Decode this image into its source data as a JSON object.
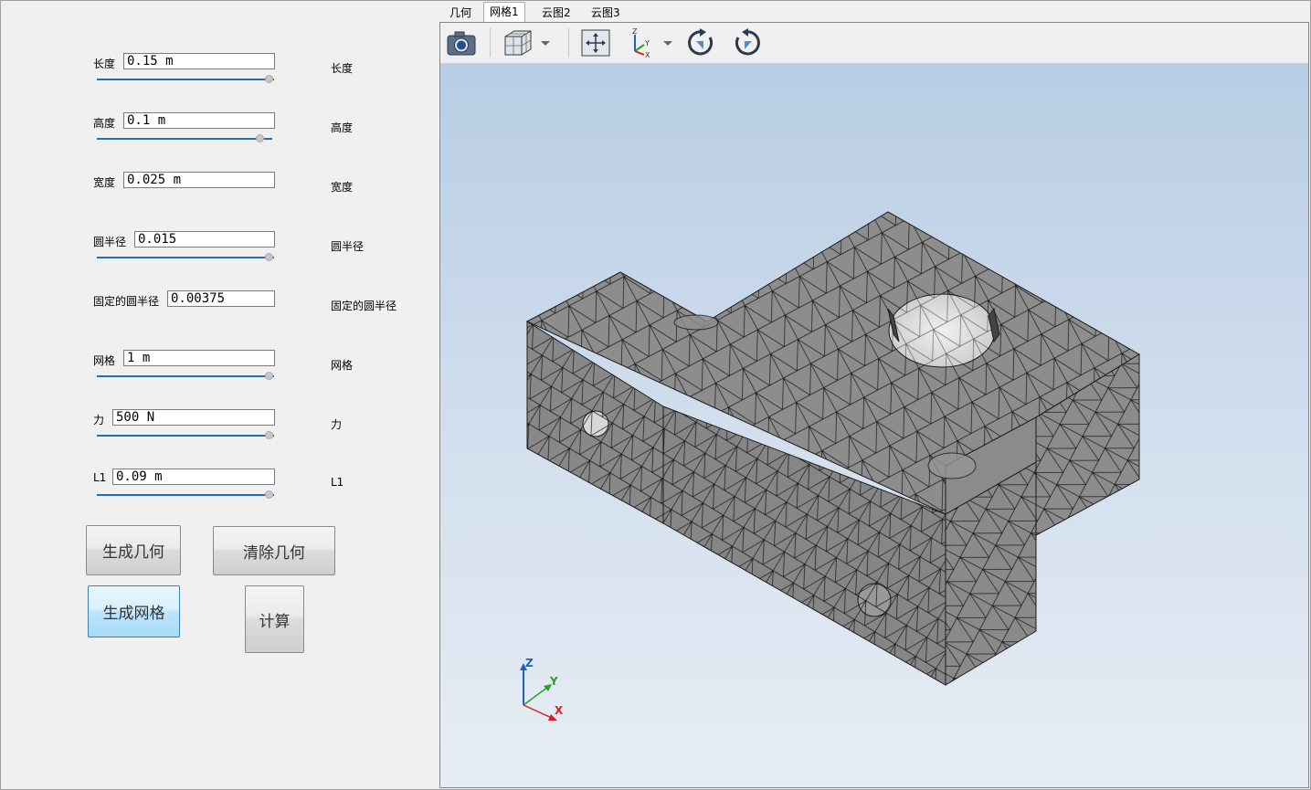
{
  "params": [
    {
      "label": "长度",
      "value": "0.15 m",
      "right": "长度",
      "slider": 0.98
    },
    {
      "label": "高度",
      "value": "0.1 m",
      "right": "高度",
      "slider": 0.92
    },
    {
      "label": "宽度",
      "value": "0.025 m",
      "right": "宽度",
      "slider": null
    },
    {
      "label": "圆半径",
      "value": "0.015",
      "right": "圆半径",
      "slider": 0.98
    },
    {
      "label": "固定的圆半径",
      "value": "0.00375",
      "right": "固定的圆半径",
      "slider": null
    },
    {
      "label": "网格",
      "value": "1 m",
      "right": "网格",
      "slider": 0.98
    },
    {
      "label": "力",
      "value": "500 N",
      "right": "力",
      "slider": 0.98
    },
    {
      "label": "L1",
      "value": "0.09 m",
      "right": "L1",
      "slider": 0.98
    }
  ],
  "buttons": {
    "generate_geometry": "生成几何",
    "clear_geometry": "清除几何",
    "generate_mesh": "生成网格",
    "compute": "计算"
  },
  "tabs": [
    "几何",
    "网格1",
    "云图2",
    "云图3"
  ],
  "selected_tab": 1,
  "toolbar": [
    "camera-icon",
    "view-cube-icon",
    "dropdown-arrow-icon",
    "zoom-extents-icon",
    "axes-orientation-icon",
    "dropdown-arrow-icon",
    "rotate-cw-icon",
    "rotate-ccw-icon"
  ],
  "axis_triad": {
    "z": "Z",
    "y": "Y",
    "x": "X"
  },
  "colors": {
    "accent": "#1e6fc0",
    "mesh_face": "#8c8c8c",
    "mesh_line": "#1a1a1a",
    "bg_top": "#b8cde4",
    "bg_bottom": "#e7edf4"
  }
}
